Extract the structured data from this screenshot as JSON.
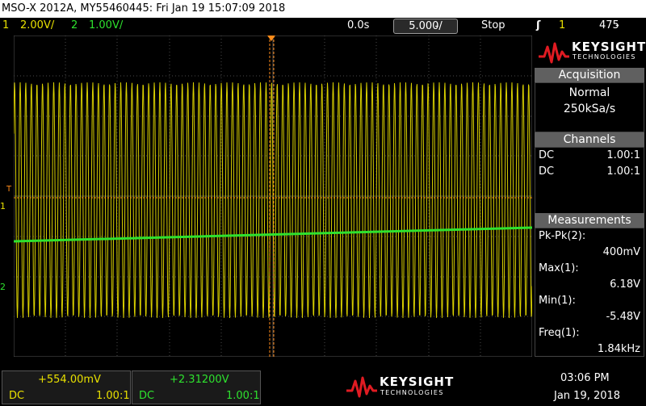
{
  "titlebar": {
    "text": "MSO-X 2012A, MY55460445: Fri Jan 19 15:07:09 2018"
  },
  "status": {
    "ch1_num": "1",
    "ch1_scale": "2.00V/",
    "ch2_num": "2",
    "ch2_scale": "1.00V/",
    "delay": "0.0s",
    "timebase": "5.000̵/",
    "run_state": "Stop",
    "trigger_icon": "ʃ",
    "trigger_ch": "1",
    "trigger_level": "475̵"
  },
  "markers": {
    "trig": "T",
    "ch1": "1",
    "ch2": "2"
  },
  "side": {
    "logo_word": "KEYSIGHT",
    "logo_sub": "TECHNOLOGIES",
    "acquisition": {
      "title": "Acquisition",
      "mode": "Normal",
      "rate": "250kSa/s"
    },
    "channels": {
      "title": "Channels",
      "rows": [
        {
          "coupling": "DC",
          "probe": "1.00:1"
        },
        {
          "coupling": "DC",
          "probe": "1.00:1"
        }
      ]
    },
    "measurements": {
      "title": "Measurements",
      "items": [
        {
          "label": "Pk-Pk(2):",
          "value": "400mV"
        },
        {
          "label": "Max(1):",
          "value": "6.18V"
        },
        {
          "label": "Min(1):",
          "value": "-5.48V"
        },
        {
          "label": "Freq(1):",
          "value": "1.84kHz"
        }
      ]
    }
  },
  "bottom": {
    "ch1": {
      "offset": "+554.00mV",
      "coupling": "DC",
      "probe": "1.00:1"
    },
    "ch2": {
      "offset": "+2.31200V",
      "coupling": "DC",
      "probe": "1.00:1"
    },
    "logo_word": "KEYSIGHT",
    "logo_sub": "TECHNOLOGIES",
    "time": "03:06 PM",
    "date": "Jan 19, 2018"
  },
  "colors": {
    "ch1": "#e8e000",
    "ch2": "#2ee22e",
    "trigger": "#ff8c1a",
    "logo_red": "#e01b22"
  },
  "icons": {
    "logo": "keysight-wave-logo"
  }
}
